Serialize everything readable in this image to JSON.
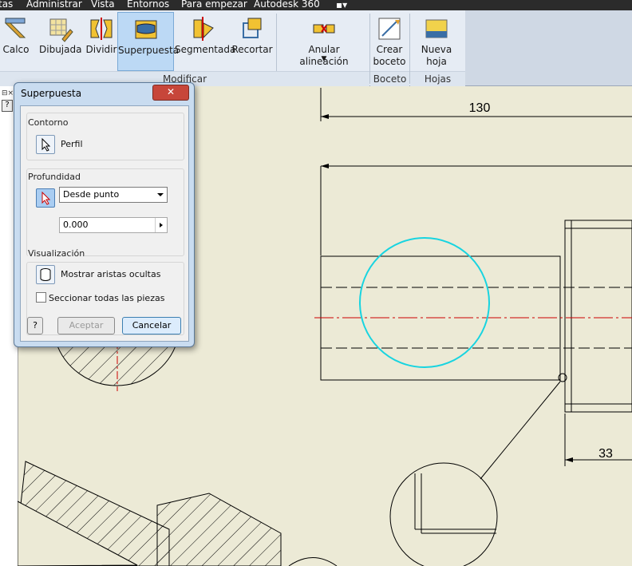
{
  "menu": [
    "tas",
    "Administrar",
    "Vista",
    "Entornos",
    "Para empezar",
    "Autodesk 360"
  ],
  "ribbon": {
    "buttons": [
      {
        "label": "Calco",
        "active": false
      },
      {
        "label": "Dibujada",
        "active": false
      },
      {
        "label": "Dividir",
        "active": false
      },
      {
        "label": "Superpuesta",
        "active": true
      },
      {
        "label": "Segmentada",
        "active": false
      },
      {
        "label": "Recortar",
        "active": false
      },
      {
        "label": "Anular alineación",
        "active": false
      },
      {
        "label": "Crear",
        "label2": "boceto",
        "active": false
      },
      {
        "label": "Nueva hoja",
        "active": false
      }
    ],
    "groups": [
      "Modificar",
      "Boceto",
      "Hojas"
    ]
  },
  "dialog": {
    "title": "Superpuesta",
    "close": "✕",
    "contorno": {
      "title": "Contorno",
      "label": "Perfil"
    },
    "profundidad": {
      "title": "Profundidad",
      "mode": "Desde punto",
      "value": "0.000"
    },
    "visualizacion": {
      "title": "Visualización",
      "hidden_edges": "Mostrar aristas ocultas",
      "section_all": "Seccionar todas las piezas"
    },
    "help": "?",
    "accept": "Aceptar",
    "cancel": "Cancelar"
  },
  "drawing": {
    "dim_top": "130",
    "dim_right": "33"
  },
  "colors": {
    "circle": "#17d4e0",
    "centerline": "#cc0000",
    "paper": "#ecead6"
  }
}
